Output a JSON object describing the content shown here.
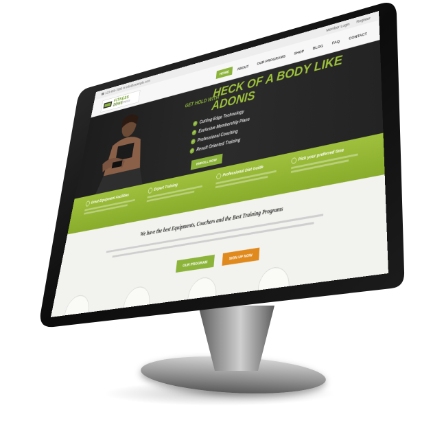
{
  "topbar": {
    "contact": "☎ 123-456-7890 ✉ info@example.com",
    "login": "Member Login",
    "register": "Register"
  },
  "logo": {
    "name": "FITNESS ZONE",
    "tagline": "GYM & FITNESS"
  },
  "nav": {
    "items": [
      "HOME",
      "ABOUT",
      "OUR PROGRAMS",
      "SHOP",
      "BLOG",
      "FAQ",
      "CONTACT"
    ],
    "active_index": 0
  },
  "hero": {
    "tagline": "Get Hold With",
    "headline": "HECK OF A BODY LIKE ADONIS",
    "bullets": [
      "Cutting Edge Technology",
      "Exclusive Membership Plans",
      "Professional Coaching",
      "Result Oriented Training"
    ],
    "cta": "ENROLL NOW"
  },
  "features": [
    {
      "title": "Great Equipment Facilities"
    },
    {
      "title": "Expert Training"
    },
    {
      "title": "Professional Diet Guide"
    },
    {
      "title": "Pick your preferred time"
    }
  ],
  "content": {
    "heading": "We have the best Equipments, Coachers and the Best Training Programs",
    "button_programs": "OUR PROGRAM",
    "button_signup": "SIGN UP NOW"
  },
  "colors": {
    "accent": "#8cb43b",
    "orange": "#e08a1e",
    "bezel": "#0f0f0f"
  }
}
